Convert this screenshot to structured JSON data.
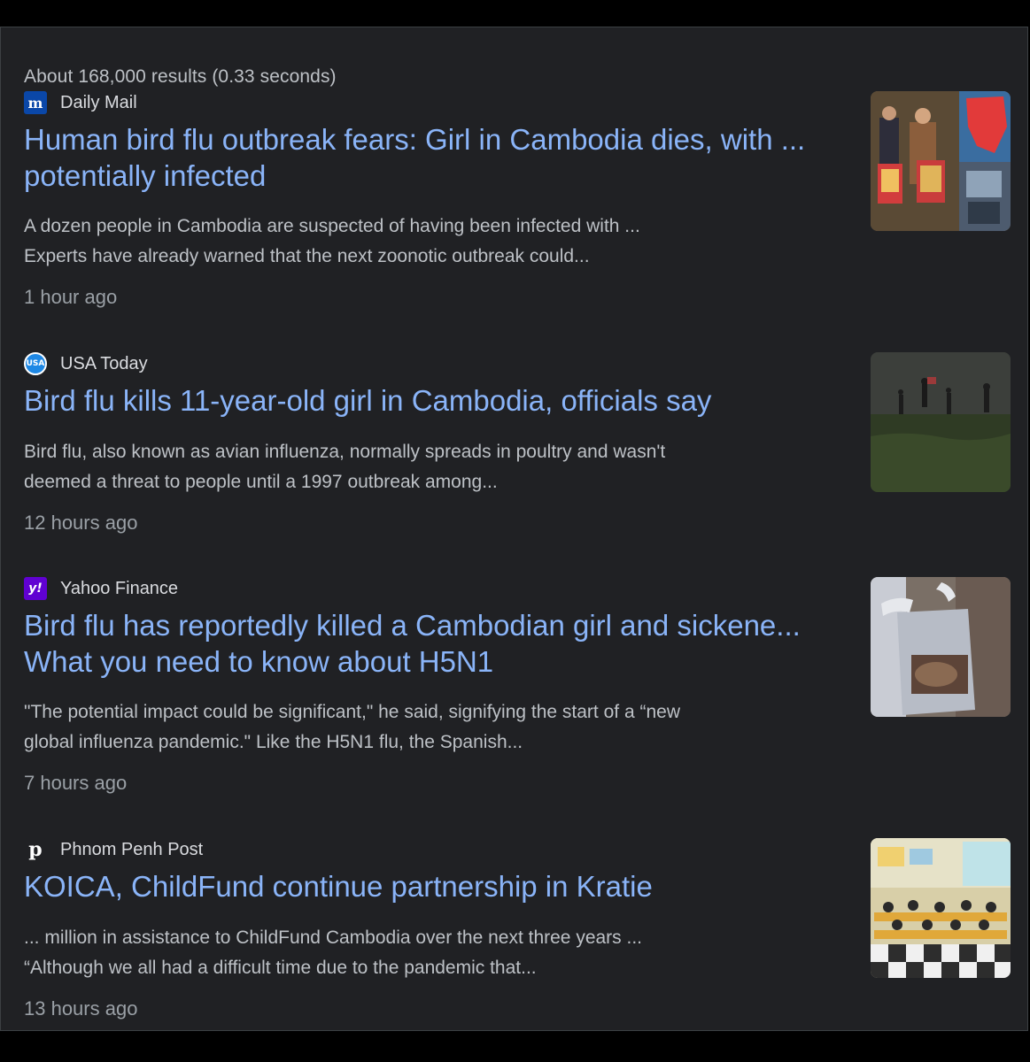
{
  "results_stats": "About 168,000 results (0.33 seconds)",
  "results": [
    {
      "source": "Daily Mail",
      "favicon_glyph": "m",
      "favicon_icon": "daily-mail-logo-icon",
      "title_lines": [
        "Human bird flu outbreak fears: Girl in Cambodia dies, with ...",
        "potentially infected"
      ],
      "snippet_lines": [
        "A dozen people in Cambodia are suspected of having been infected with ...",
        "Experts have already warned that the next zoonotic outbreak could..."
      ],
      "time": "1 hour ago"
    },
    {
      "source": "USA Today",
      "favicon_glyph": "USA",
      "favicon_icon": "usa-today-logo-icon",
      "title_lines": [
        "Bird flu kills 11-year-old girl in Cambodia, officials say"
      ],
      "snippet_lines": [
        "Bird flu, also known as avian influenza, normally spreads in poultry and wasn't",
        "deemed a threat to people until a 1997 outbreak among..."
      ],
      "time": "12 hours ago"
    },
    {
      "source": "Yahoo Finance",
      "favicon_glyph": "y!",
      "favicon_icon": "yahoo-logo-icon",
      "title_lines": [
        "Bird flu has reportedly killed a Cambodian girl and sickene...",
        "What you need to know about H5N1"
      ],
      "snippet_lines": [
        "\"The potential impact could be significant,\" he said, signifying the start of a “new",
        "global influenza pandemic.\" Like the H5N1 flu, the Spanish..."
      ],
      "time": "7 hours ago"
    },
    {
      "source": "Phnom Penh Post",
      "favicon_glyph": "p",
      "favicon_icon": "phnom-penh-post-logo-icon",
      "title_lines": [
        "KOICA, ChildFund continue partnership in Kratie"
      ],
      "snippet_lines": [
        "... million in assistance to ChildFund Cambodia over the next three years ...",
        "“Although we all had a difficult time due to the pandemic that..."
      ],
      "time": "13 hours ago"
    }
  ],
  "colors": {
    "background": "#202124",
    "title_link": "#8ab4f8",
    "snippet": "#bdc1c6",
    "meta": "#9aa0a6"
  }
}
